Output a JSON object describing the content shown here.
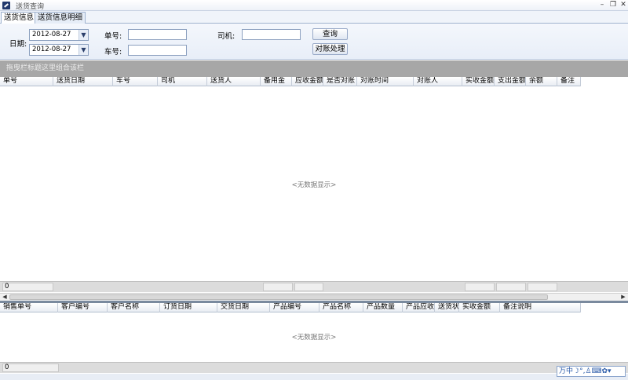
{
  "window": {
    "title": "送货查询",
    "minimize_glyph": "–",
    "restore_glyph": "❐",
    "close_glyph": "✕"
  },
  "tabs": [
    {
      "label": "送货信息",
      "active": true
    },
    {
      "label": "送货信息明细",
      "active": false
    }
  ],
  "filters": {
    "date_label": "日期:",
    "date_from": "2012-08-27",
    "date_to": "2012-08-27",
    "order_no_label": "单号:",
    "order_no_value": "",
    "plate_label": "车号:",
    "plate_value": "",
    "driver_label": "司机:",
    "driver_value": "",
    "query_button": "查询",
    "reconcile_button": "对账处理"
  },
  "group_panel_text": "拖曳栏标题这里组合该栏",
  "main_grid": {
    "columns": [
      "单号",
      "送货日期",
      "车号",
      "司机",
      "送货人",
      "备用金",
      "应收金额",
      "是否对账",
      "对账时间",
      "对账人",
      "实收金额",
      "支出金额",
      "余额",
      "备注"
    ],
    "empty_text": "<无数据显示>",
    "footer_count": "0"
  },
  "detail_grid": {
    "columns": [
      "销售单号",
      "客户编号",
      "客户名称",
      "订货日期",
      "交货日期",
      "产品编号",
      "产品名称",
      "产品数量",
      "产品应收",
      "送货状",
      "实收金额",
      "备注说明"
    ],
    "empty_text": "<无数据显示>",
    "footer_count": "0"
  },
  "ime_bar": {
    "text": "万中☽°,♙⌨✿▾"
  }
}
